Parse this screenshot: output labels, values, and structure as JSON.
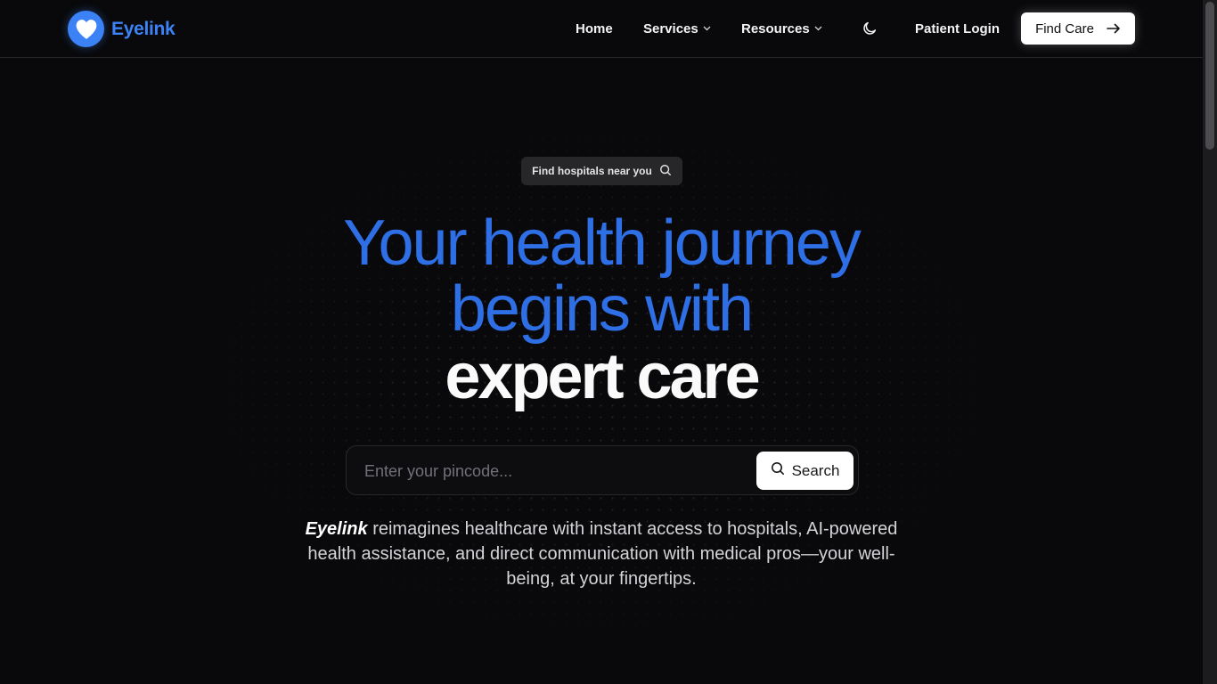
{
  "header": {
    "brand": "Eyelink",
    "nav": {
      "home": "Home",
      "services": "Services",
      "resources": "Resources",
      "patient_login": "Patient Login",
      "find_care": "Find Care"
    }
  },
  "hero": {
    "pill_label": "Find hospitals near you",
    "headline_line1": "Your health journey",
    "headline_line2": "begins with",
    "headline_line3": "expert care",
    "search": {
      "placeholder": "Enter your pincode...",
      "value": "",
      "button_label": "Search"
    },
    "tagline_brand": "Eyelink",
    "tagline_text": " reimagines healthcare with instant access to hospitals, AI-powered health assistance, and direct communication with medical pros—your well-being, at your fingertips."
  },
  "icons": {
    "logo": "heart-icon",
    "theme": "moon-icon",
    "chevron": "chevron-down-icon",
    "arrow": "arrow-right-icon",
    "search": "search-icon"
  },
  "colors": {
    "accent": "#2f6fe6",
    "logo_blue": "#3b82f6",
    "background": "#09090b",
    "button_bg": "#ffffff"
  }
}
